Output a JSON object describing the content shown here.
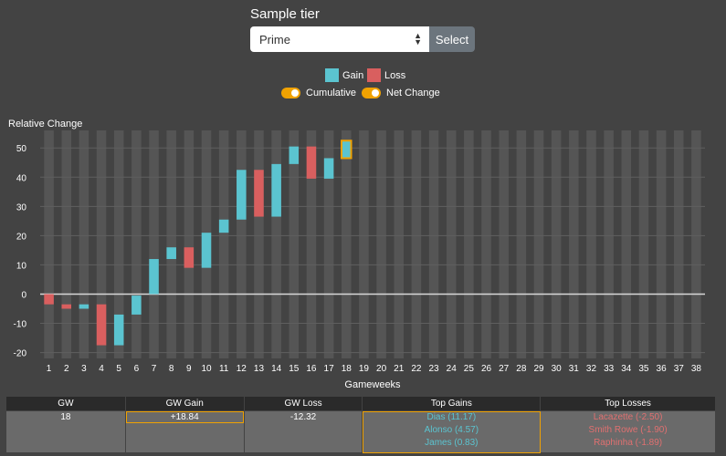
{
  "controls": {
    "tier_label": "Sample tier",
    "tier_value": "Prime",
    "select_label": "Select"
  },
  "legend": {
    "gain_label": "Gain",
    "loss_label": "Loss",
    "gain_color": "#5bc4d0",
    "loss_color": "#d95f5f"
  },
  "toggles": {
    "cumulative_label": "Cumulative",
    "cumulative_on": true,
    "net_change_label": "Net Change",
    "net_change_on": true
  },
  "chart_data": {
    "type": "bar",
    "subtype": "waterfall",
    "title": "",
    "ylabel": "Relative Change",
    "xlabel": "Gameweeks",
    "ylim": [
      -22,
      56
    ],
    "yticks": [
      -20,
      -10,
      0,
      10,
      20,
      30,
      40,
      50
    ],
    "categories": [
      "1",
      "2",
      "3",
      "4",
      "5",
      "6",
      "7",
      "8",
      "9",
      "10",
      "11",
      "12",
      "13",
      "14",
      "15",
      "16",
      "17",
      "18",
      "19",
      "20",
      "21",
      "22",
      "23",
      "24",
      "25",
      "26",
      "27",
      "28",
      "29",
      "30",
      "31",
      "32",
      "33",
      "34",
      "35",
      "36",
      "37",
      "38"
    ],
    "series": [
      {
        "name": "Gain",
        "color": "#5bc4d0",
        "bars": [
          {
            "gw": 3,
            "start": -3.5,
            "end": -5
          },
          {
            "gw": 5,
            "start": -7,
            "end": -17.5
          },
          {
            "gw": 6,
            "start": -7,
            "end": -0.5
          },
          {
            "gw": 7,
            "start": 0,
            "end": 12
          },
          {
            "gw": 8,
            "start": 12,
            "end": 16
          },
          {
            "gw": 10,
            "start": 9,
            "end": 21
          },
          {
            "gw": 11,
            "start": 21,
            "end": 25.5
          },
          {
            "gw": 12,
            "start": 25.5,
            "end": 42.5
          },
          {
            "gw": 14,
            "start": 26.5,
            "end": 44.5
          },
          {
            "gw": 15,
            "start": 44.5,
            "end": 50.5
          },
          {
            "gw": 17,
            "start": 39.5,
            "end": 46.5
          },
          {
            "gw": 18,
            "start": 46.5,
            "end": 52.5
          }
        ]
      },
      {
        "name": "Loss",
        "color": "#d95f5f",
        "bars": [
          {
            "gw": 1,
            "start": 0,
            "end": -3.5
          },
          {
            "gw": 2,
            "start": -3.5,
            "end": -5
          },
          {
            "gw": 4,
            "start": -3.5,
            "end": -17.5
          },
          {
            "gw": 9,
            "start": 16,
            "end": 9
          },
          {
            "gw": 13,
            "start": 42.5,
            "end": 26.5
          },
          {
            "gw": 16,
            "start": 50.5,
            "end": 39.5
          }
        ]
      }
    ],
    "highlighted_gw": "18",
    "grid": true
  },
  "table": {
    "headers": [
      "GW",
      "GW Gain",
      "GW Loss",
      "Top Gains",
      "Top Losses"
    ],
    "gw": "18",
    "gw_gain": "+18.84",
    "gw_loss": "-12.32",
    "top_gains": [
      "Dias (11.17)",
      "Alonso (4.57)",
      "James (0.83)"
    ],
    "top_losses": [
      "Lacazette (-2.50)",
      "Smith Rowe (-1.90)",
      "Raphinha (-1.89)"
    ]
  }
}
